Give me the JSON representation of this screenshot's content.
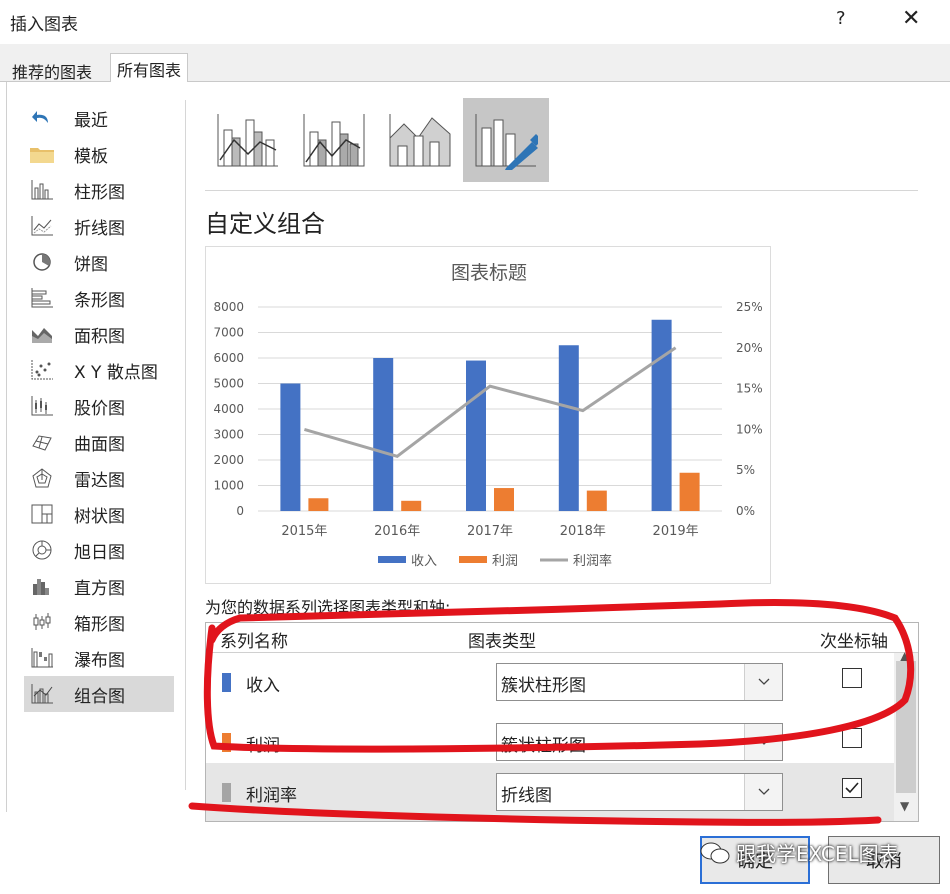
{
  "window": {
    "title": "插入图表",
    "help": "?",
    "close": "✕"
  },
  "tabs": [
    {
      "label": "推荐的图表"
    },
    {
      "label": "所有图表"
    }
  ],
  "sidebar": {
    "items": [
      {
        "label": "最近",
        "icon": "undo-icon"
      },
      {
        "label": "模板",
        "icon": "folder-icon"
      },
      {
        "label": "柱形图",
        "icon": "column-chart-icon"
      },
      {
        "label": "折线图",
        "icon": "line-chart-icon"
      },
      {
        "label": "饼图",
        "icon": "pie-chart-icon"
      },
      {
        "label": "条形图",
        "icon": "bar-chart-icon"
      },
      {
        "label": "面积图",
        "icon": "area-chart-icon"
      },
      {
        "label": "X Y 散点图",
        "icon": "scatter-chart-icon"
      },
      {
        "label": "股价图",
        "icon": "stock-chart-icon"
      },
      {
        "label": "曲面图",
        "icon": "surface-chart-icon"
      },
      {
        "label": "雷达图",
        "icon": "radar-chart-icon"
      },
      {
        "label": "树状图",
        "icon": "treemap-chart-icon"
      },
      {
        "label": "旭日图",
        "icon": "sunburst-chart-icon"
      },
      {
        "label": "直方图",
        "icon": "histogram-chart-icon"
      },
      {
        "label": "箱形图",
        "icon": "boxplot-chart-icon"
      },
      {
        "label": "瀑布图",
        "icon": "waterfall-chart-icon"
      },
      {
        "label": "组合图",
        "icon": "combo-chart-icon",
        "active": true
      }
    ]
  },
  "combo_types": {
    "selected_index": 3
  },
  "section": {
    "title": "自定义组合",
    "assign_label": "为您的数据系列选择图表类型和轴:"
  },
  "chart_data": {
    "type": "bar",
    "title": "图表标题",
    "categories": [
      "2015年",
      "2016年",
      "2017年",
      "2018年",
      "2019年"
    ],
    "series": [
      {
        "name": "收入",
        "type": "bar",
        "axis": "primary",
        "color": "#4472c4",
        "values": [
          5000,
          6000,
          5900,
          6500,
          7500
        ]
      },
      {
        "name": "利润",
        "type": "bar",
        "axis": "primary",
        "color": "#ed7d31",
        "values": [
          500,
          400,
          900,
          800,
          1500
        ]
      },
      {
        "name": "利润率",
        "type": "line",
        "axis": "secondary",
        "color": "#a5a5a5",
        "values": [
          10,
          6.7,
          15.3,
          12.3,
          20
        ]
      }
    ],
    "ylim": [
      0,
      8000
    ],
    "yticks": [
      "0",
      "1000",
      "2000",
      "3000",
      "4000",
      "5000",
      "6000",
      "7000",
      "8000"
    ],
    "y2lim": [
      0,
      25
    ],
    "y2ticks": [
      "0%",
      "5%",
      "10%",
      "15%",
      "20%",
      "25%"
    ],
    "grid": true,
    "legend": "bottom"
  },
  "table": {
    "headers": {
      "name": "系列名称",
      "type": "图表类型",
      "secondary": "次坐标轴"
    },
    "rows": [
      {
        "name": "收入",
        "color": "#4472c4",
        "type": "簇状柱形图",
        "secondary": false
      },
      {
        "name": "利润",
        "color": "#ed7d31",
        "type": "簇状柱形图",
        "secondary": false
      },
      {
        "name": "利润率",
        "color": "#a5a5a5",
        "type": "折线图",
        "secondary": true
      }
    ]
  },
  "buttons": {
    "ok": "确定",
    "cancel": "取消"
  },
  "watermark": "跟我学EXCEL图表"
}
